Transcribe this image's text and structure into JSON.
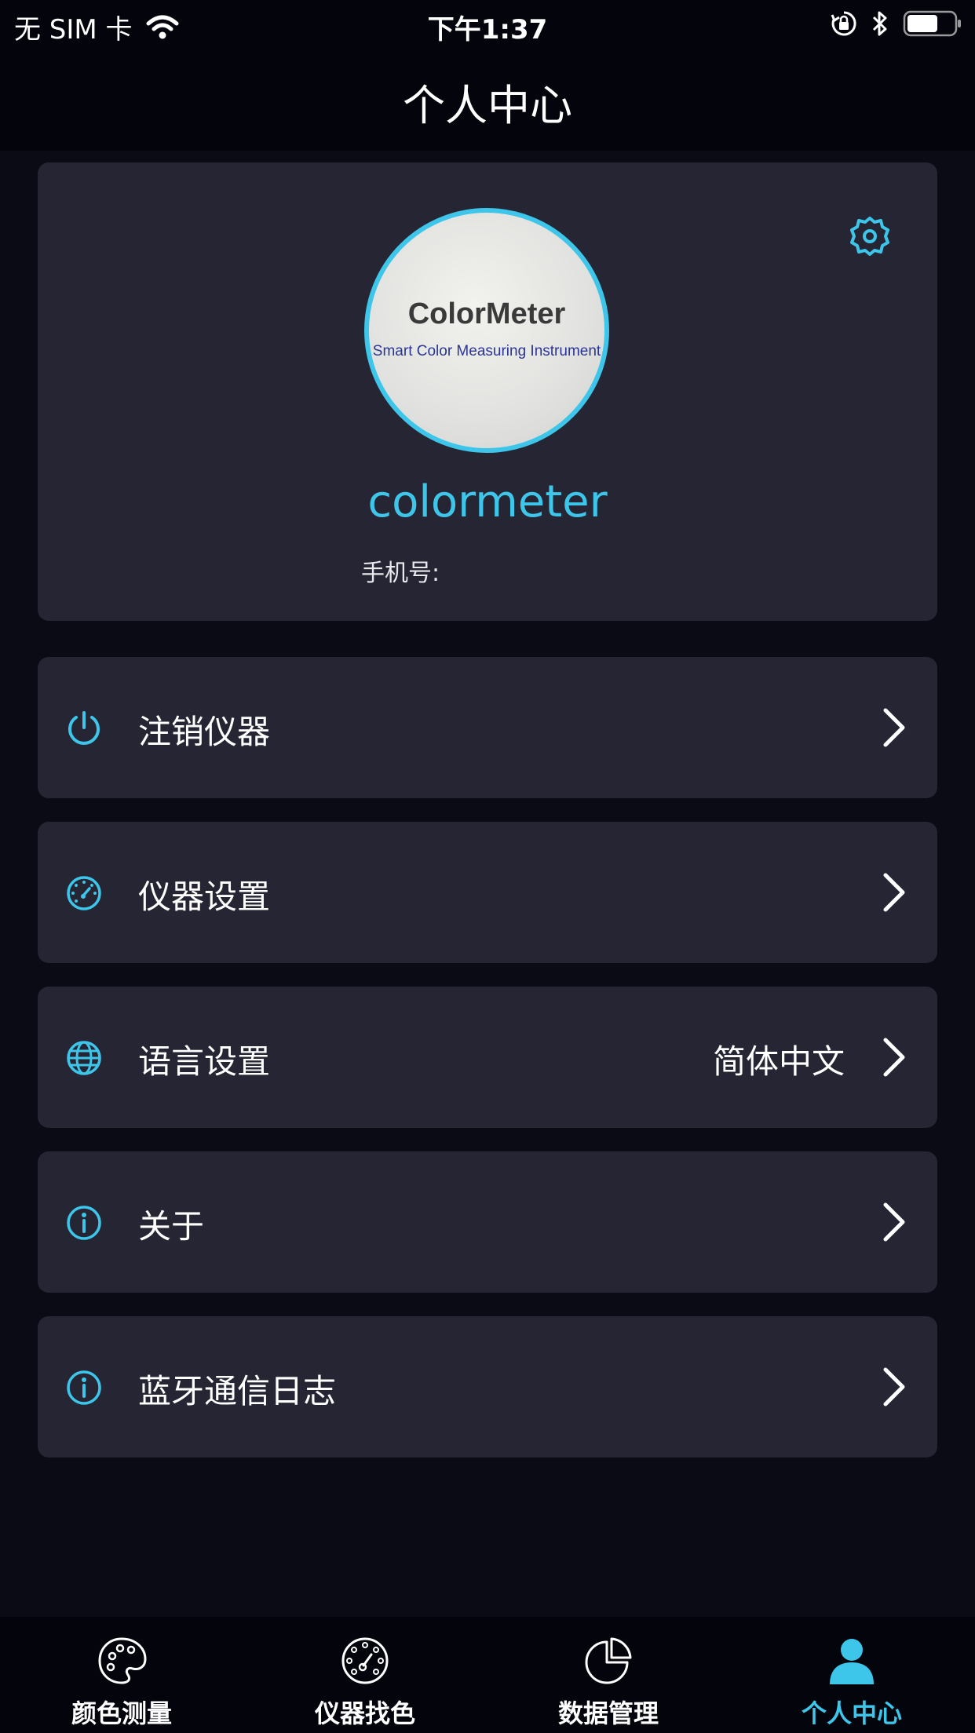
{
  "status_bar": {
    "carrier": "无 SIM 卡",
    "time": "下午1:37"
  },
  "nav": {
    "title": "个人中心"
  },
  "profile": {
    "avatar_logo_title": "ColorMeter",
    "avatar_logo_subtitle": "Smart Color Measuring Instrument",
    "username": "colormeter",
    "phone_label": "手机号:"
  },
  "menu": [
    {
      "label": "注销仪器",
      "icon": "power-icon"
    },
    {
      "label": "仪器设置",
      "icon": "gauge-icon"
    },
    {
      "label": "语言设置",
      "icon": "globe-icon",
      "value": "简体中文"
    },
    {
      "label": "关于",
      "icon": "info-icon"
    },
    {
      "label": "蓝牙通信日志",
      "icon": "info-icon"
    }
  ],
  "tabs": [
    {
      "label": "颜色测量",
      "icon": "palette-icon"
    },
    {
      "label": "仪器找色",
      "icon": "device-dial-icon"
    },
    {
      "label": "数据管理",
      "icon": "pie-chart-icon"
    },
    {
      "label": "个人中心",
      "icon": "person-icon",
      "active": true
    }
  ],
  "colors": {
    "accent": "#3ec6ea",
    "background": "#0b0b16",
    "card": "#252533",
    "bar": "#04040c"
  }
}
